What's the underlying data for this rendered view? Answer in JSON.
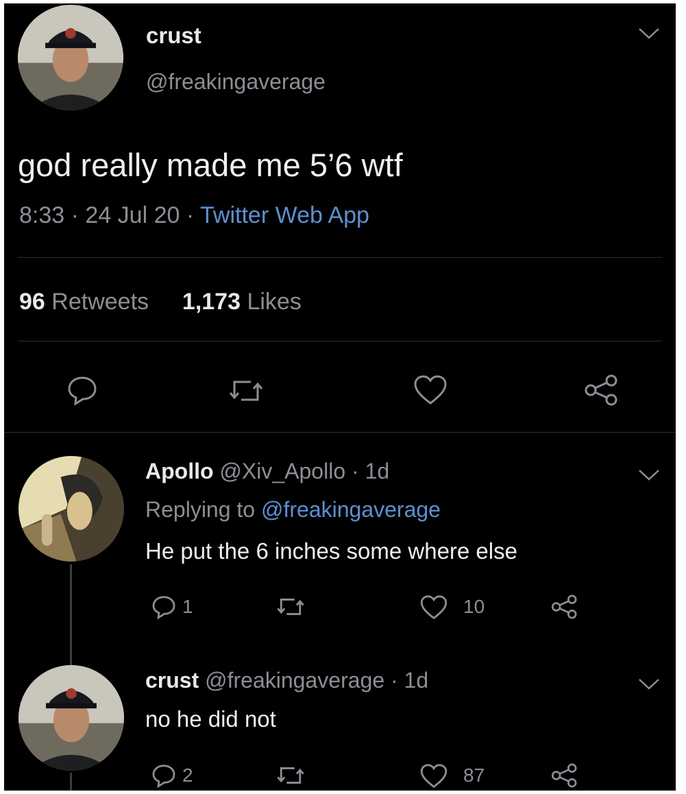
{
  "main_tweet": {
    "display_name": "crust",
    "handle": "@freakingaverage",
    "text": "god really made me 5’6 wtf",
    "time": "8:33",
    "date": "24 Jul 20",
    "source": "Twitter Web App",
    "retweets_count": "96",
    "retweets_label": "Retweets",
    "likes_count": "1,173",
    "likes_label": "Likes"
  },
  "replies": [
    {
      "display_name": "Apollo",
      "handle": "@Xiv_Apollo",
      "age": "1d",
      "replying_prefix": "Replying to",
      "replying_to": "@freakingaverage",
      "text": "He put the 6 inches some where else",
      "reply_count": "1",
      "retweet_count": "",
      "like_count": "10"
    },
    {
      "display_name": "crust",
      "handle": "@freakingaverage",
      "age": "1d",
      "text": "no he did not",
      "reply_count": "2",
      "retweet_count": "",
      "like_count": "87"
    }
  ],
  "colors": {
    "background": "#000000",
    "text": "#efefef",
    "muted": "#8b8f95",
    "link": "#5e8fd1"
  },
  "icons": [
    "chevron-down-icon",
    "reply-icon",
    "retweet-icon",
    "like-icon",
    "share-icon"
  ]
}
